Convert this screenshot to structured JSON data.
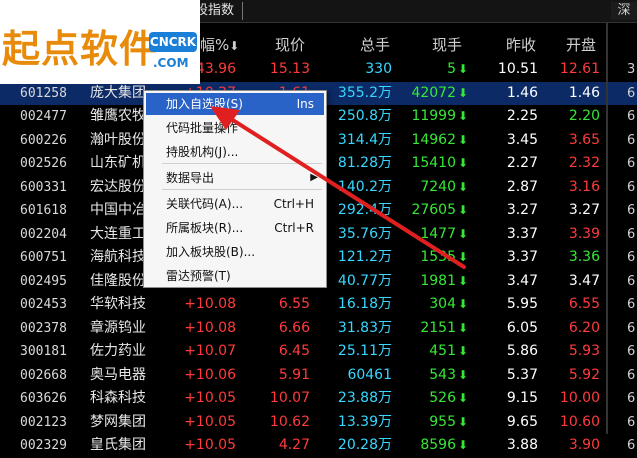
{
  "logo": {
    "main": "起点软件",
    "badge_top": "CNCRK",
    "badge_bottom": ".COM"
  },
  "topbar": {
    "tab": "股指数",
    "right_tab": "深"
  },
  "headers": {
    "chg": "幅%",
    "sort_icon": "⬇",
    "price": "现价",
    "vol": "总手",
    "hand": "现手",
    "prev": "昨收",
    "open": "开盘",
    "more": ""
  },
  "rows": [
    {
      "code": "",
      "name": "",
      "chg": "+43.96",
      "price": "15.13",
      "vol": "330",
      "hand": "5",
      "prev": "10.51",
      "open": "12.61",
      "right": "3",
      "sel": false
    },
    {
      "code": "601258",
      "name": "庞大集团",
      "chg": "+10.27",
      "price": "1.61",
      "vol": "355.2万",
      "hand": "42072",
      "prev": "1.46",
      "open": "1.46",
      "right": "6",
      "sel": true
    },
    {
      "code": "002477",
      "name": "雏鹰农牧",
      "chg": "",
      "price": "",
      "vol": "250.8万",
      "hand": "11999",
      "prev": "2.25",
      "open": "2.20",
      "right": "6",
      "sel": false
    },
    {
      "code": "600226",
      "name": "瀚叶股份",
      "chg": "",
      "price": "",
      "vol": "314.4万",
      "hand": "14962",
      "prev": "3.45",
      "open": "3.65",
      "right": "6",
      "sel": false
    },
    {
      "code": "002526",
      "name": "山东矿机",
      "chg": "",
      "price": "",
      "vol": "81.28万",
      "hand": "15410",
      "prev": "2.27",
      "open": "2.32",
      "right": "6",
      "sel": false
    },
    {
      "code": "600331",
      "name": "宏达股份",
      "chg": "",
      "price": "",
      "vol": "140.2万",
      "hand": "7240",
      "prev": "2.87",
      "open": "3.16",
      "right": "6",
      "sel": false
    },
    {
      "code": "601618",
      "name": "中国中冶",
      "chg": "",
      "price": "",
      "vol": "292.4万",
      "hand": "27605",
      "prev": "3.27",
      "open": "3.27",
      "right": "6",
      "sel": false
    },
    {
      "code": "002204",
      "name": "大连重工",
      "chg": "",
      "price": "",
      "vol": "35.76万",
      "hand": "1477",
      "prev": "3.37",
      "open": "3.39",
      "right": "6",
      "sel": false
    },
    {
      "code": "600751",
      "name": "海航科技",
      "chg": "",
      "price": "",
      "vol": "121.2万",
      "hand": "1535",
      "prev": "3.37",
      "open": "3.36",
      "right": "6",
      "sel": false
    },
    {
      "code": "002495",
      "name": "佳隆股份",
      "chg": "",
      "price": "",
      "vol": "40.77万",
      "hand": "1981",
      "prev": "3.47",
      "open": "3.47",
      "right": "6",
      "sel": false
    },
    {
      "code": "002453",
      "name": "华软科技",
      "chg": "+10.08",
      "price": "6.55",
      "vol": "16.18万",
      "hand": "304",
      "prev": "5.95",
      "open": "6.55",
      "right": "6",
      "sel": false
    },
    {
      "code": "002378",
      "name": "章源钨业",
      "chg": "+10.08",
      "price": "6.66",
      "vol": "31.83万",
      "hand": "2151",
      "prev": "6.05",
      "open": "6.20",
      "right": "6",
      "sel": false
    },
    {
      "code": "300181",
      "name": "佐力药业",
      "chg": "+10.07",
      "price": "6.45",
      "vol": "25.11万",
      "hand": "451",
      "prev": "5.86",
      "open": "5.93",
      "right": "6",
      "sel": false
    },
    {
      "code": "002668",
      "name": "奥马电器",
      "chg": "+10.06",
      "price": "5.91",
      "vol": "60461",
      "hand": "543",
      "prev": "5.37",
      "open": "5.92",
      "right": "6",
      "sel": false
    },
    {
      "code": "603626",
      "name": "科森科技",
      "chg": "+10.05",
      "price": "10.07",
      "vol": "23.88万",
      "hand": "526",
      "prev": "9.15",
      "open": "10.00",
      "right": "6",
      "sel": false
    },
    {
      "code": "002123",
      "name": "梦网集团",
      "chg": "+10.05",
      "price": "10.62",
      "vol": "13.39万",
      "hand": "955",
      "prev": "9.65",
      "open": "10.60",
      "right": "6",
      "sel": false
    },
    {
      "code": "002329",
      "name": "皇氏集团",
      "chg": "+10.05",
      "price": "4.27",
      "vol": "20.28万",
      "hand": "8596",
      "prev": "3.88",
      "open": "3.90",
      "right": "6",
      "sel": false
    }
  ],
  "menu": {
    "items": [
      {
        "label": "加入自选股(S)",
        "shortcut": "Ins"
      },
      {
        "label": "代码批量操作",
        "shortcut": ""
      },
      {
        "label": "持股机构(J)...",
        "shortcut": ""
      },
      {
        "label": "数据导出",
        "shortcut": ""
      },
      {
        "label": "关联代码(A)...",
        "shortcut": "Ctrl+H"
      },
      {
        "label": "所属板块(R)...",
        "shortcut": "Ctrl+R"
      },
      {
        "label": "加入板块股(B)...",
        "shortcut": ""
      },
      {
        "label": "雷达预警(T)",
        "shortcut": ""
      }
    ]
  },
  "colors": {
    "up": "#ff3b3b",
    "down_arrow": "#36e836",
    "vol": "#38d7ff",
    "selected": "#0b2a66",
    "menu_highlight": "#2a63c7",
    "annotation": "#e02020"
  }
}
